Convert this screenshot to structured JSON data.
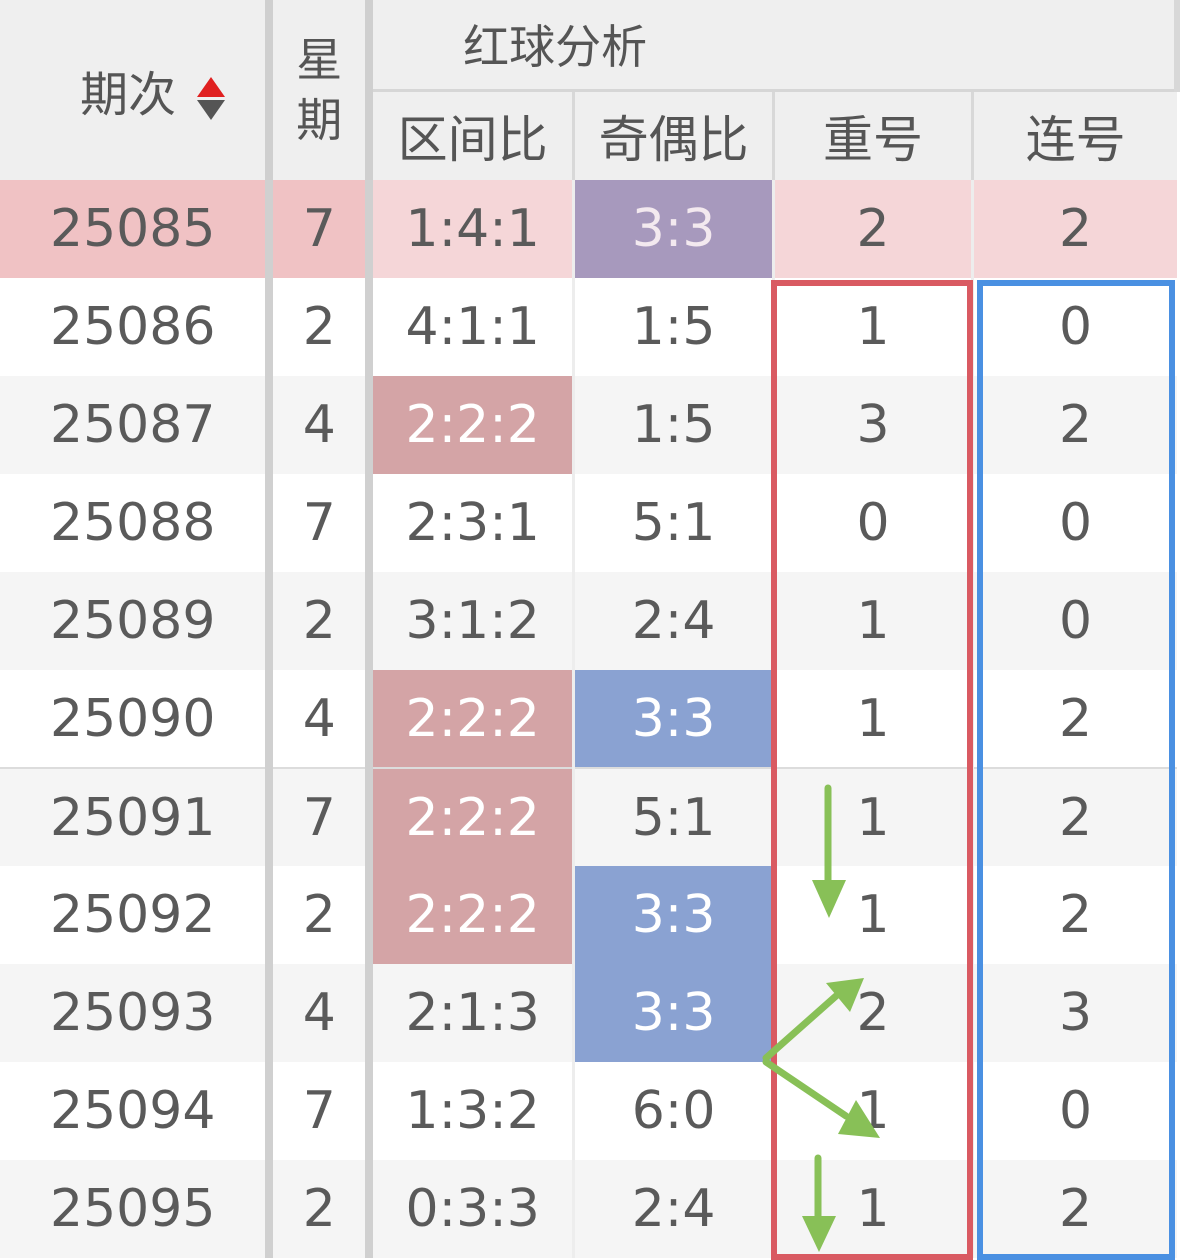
{
  "headers": {
    "issue": "期次",
    "week": "星期",
    "red_analysis": "红球分析",
    "zone_ratio": "区间比",
    "odd_even_ratio": "奇偶比",
    "repeat_num": "重号",
    "consecutive_num": "连号"
  },
  "icons": {
    "sort": "sort-up-down-icon"
  },
  "colors": {
    "pink_highlight": "#d4a4a6",
    "blue_highlight": "#8aa2d2",
    "purple_highlight": "#a799bd",
    "selected_row": "#f5d6d8",
    "red_box": "#d95a62",
    "blue_box": "#4a90e2",
    "green_arrow": "#88c057"
  },
  "rows": [
    {
      "issue": "25085",
      "week": "7",
      "zone": "1:4:1",
      "odd": "3:3",
      "rep": "2",
      "cons": "2",
      "zone_hl": "",
      "odd_hl": "purple"
    },
    {
      "issue": "25086",
      "week": "2",
      "zone": "4:1:1",
      "odd": "1:5",
      "rep": "1",
      "cons": "0",
      "zone_hl": "",
      "odd_hl": ""
    },
    {
      "issue": "25087",
      "week": "4",
      "zone": "2:2:2",
      "odd": "1:5",
      "rep": "3",
      "cons": "2",
      "zone_hl": "pink",
      "odd_hl": ""
    },
    {
      "issue": "25088",
      "week": "7",
      "zone": "2:3:1",
      "odd": "5:1",
      "rep": "0",
      "cons": "0",
      "zone_hl": "",
      "odd_hl": ""
    },
    {
      "issue": "25089",
      "week": "2",
      "zone": "3:1:2",
      "odd": "2:4",
      "rep": "1",
      "cons": "0",
      "zone_hl": "",
      "odd_hl": ""
    },
    {
      "issue": "25090",
      "week": "4",
      "zone": "2:2:2",
      "odd": "3:3",
      "rep": "1",
      "cons": "2",
      "zone_hl": "pink",
      "odd_hl": "blue"
    },
    {
      "issue": "25091",
      "week": "7",
      "zone": "2:2:2",
      "odd": "5:1",
      "rep": "1",
      "cons": "2",
      "zone_hl": "pink",
      "odd_hl": ""
    },
    {
      "issue": "25092",
      "week": "2",
      "zone": "2:2:2",
      "odd": "3:3",
      "rep": "1",
      "cons": "2",
      "zone_hl": "pink",
      "odd_hl": "blue"
    },
    {
      "issue": "25093",
      "week": "4",
      "zone": "2:1:3",
      "odd": "3:3",
      "rep": "2",
      "cons": "3",
      "zone_hl": "",
      "odd_hl": "blue"
    },
    {
      "issue": "25094",
      "week": "7",
      "zone": "1:3:2",
      "odd": "6:0",
      "rep": "1",
      "cons": "0",
      "zone_hl": "",
      "odd_hl": ""
    },
    {
      "issue": "25095",
      "week": "2",
      "zone": "0:3:3",
      "odd": "2:4",
      "rep": "1",
      "cons": "2",
      "zone_hl": "",
      "odd_hl": ""
    }
  ]
}
